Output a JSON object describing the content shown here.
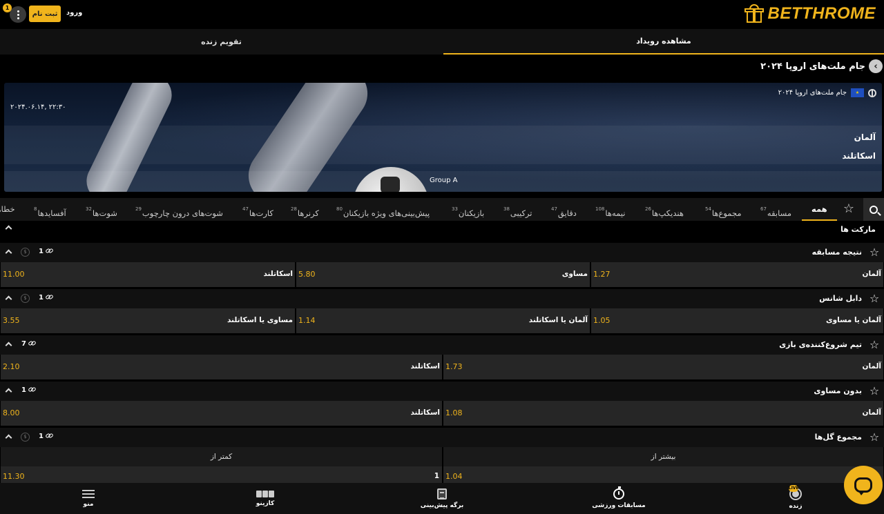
{
  "header": {
    "logo_text": "BETTHROME",
    "register_label": "ثبت نام",
    "login_label": "ورود",
    "notif_count": "1",
    "brand_color": "#f0b41c"
  },
  "top_tabs": {
    "event_view": "مشاهده رویداد",
    "live_calendar": "تقویم زنده"
  },
  "competition": {
    "title": "جام ملت‌های اروپا ۲۰۲۴"
  },
  "banner": {
    "competition": "جام ملت‌های اروپا ۲۰۲۴",
    "datetime": "۲۰۲۴.۰۶.۱۴, ۲۲:۳۰",
    "team_home": "آلمان",
    "team_away": "اسکاتلند",
    "group": "Group A"
  },
  "market_tabs": [
    {
      "label": "همه",
      "count": ""
    },
    {
      "label": "مسابقه",
      "count": "67"
    },
    {
      "label": "مجموع‌ها",
      "count": "54"
    },
    {
      "label": "هندیکپ‌ها",
      "count": "26"
    },
    {
      "label": "نیمه‌ها",
      "count": "108"
    },
    {
      "label": "دقایق",
      "count": "47"
    },
    {
      "label": "ترکیبی",
      "count": "38"
    },
    {
      "label": "بازیکنان",
      "count": "33"
    },
    {
      "label": "پیش‌بینی‌های ویژه بازیکنان",
      "count": "80"
    },
    {
      "label": "کرنرها",
      "count": "28"
    },
    {
      "label": "کارت‌ها",
      "count": "47"
    },
    {
      "label": "شوت‌های درون چارچوب",
      "count": "29"
    },
    {
      "label": "شوت‌ها",
      "count": "32"
    },
    {
      "label": "آفسایدها",
      "count": "8"
    },
    {
      "label": "خطاها",
      "count": ""
    }
  ],
  "markets_label": "مارکت ها",
  "markets": [
    {
      "title": "نتیجه مسابقه",
      "count": "1",
      "outcomes": [
        {
          "name": "آلمان",
          "odds": "1.27"
        },
        {
          "name": "مساوی",
          "odds": "5.80"
        },
        {
          "name": "اسکاتلند",
          "odds": "11.00"
        }
      ]
    },
    {
      "title": "دابل شانس",
      "count": "1",
      "outcomes": [
        {
          "name": "آلمان یا مساوی",
          "odds": "1.05"
        },
        {
          "name": "آلمان یا اسکاتلند",
          "odds": "1.14"
        },
        {
          "name": "مساوی یا اسکاتلند",
          "odds": "3.55"
        }
      ]
    },
    {
      "title": "تیم شروع‌کننده‌ی بازی",
      "count": "7",
      "outcomes": [
        {
          "name": "آلمان",
          "odds": "1.73"
        },
        {
          "name": "اسکاتلند",
          "odds": "2.10"
        }
      ]
    },
    {
      "title": "بدون مساوی",
      "count": "1",
      "outcomes": [
        {
          "name": "آلمان",
          "odds": "1.08"
        },
        {
          "name": "اسکاتلند",
          "odds": "8.00"
        }
      ]
    },
    {
      "title": "مجموع گل‌ها",
      "count": "1",
      "over_label": "بیشتر از",
      "under_label": "کمتر از",
      "line": "1",
      "over_odds": "1.04",
      "under_odds": "11.30"
    }
  ],
  "bottom_nav": {
    "menu": "منو",
    "casino": "کازینو",
    "bet_slip": "برگه پیش‌بینی",
    "sports": "مسابقات ورزشی",
    "live": "زنده"
  }
}
